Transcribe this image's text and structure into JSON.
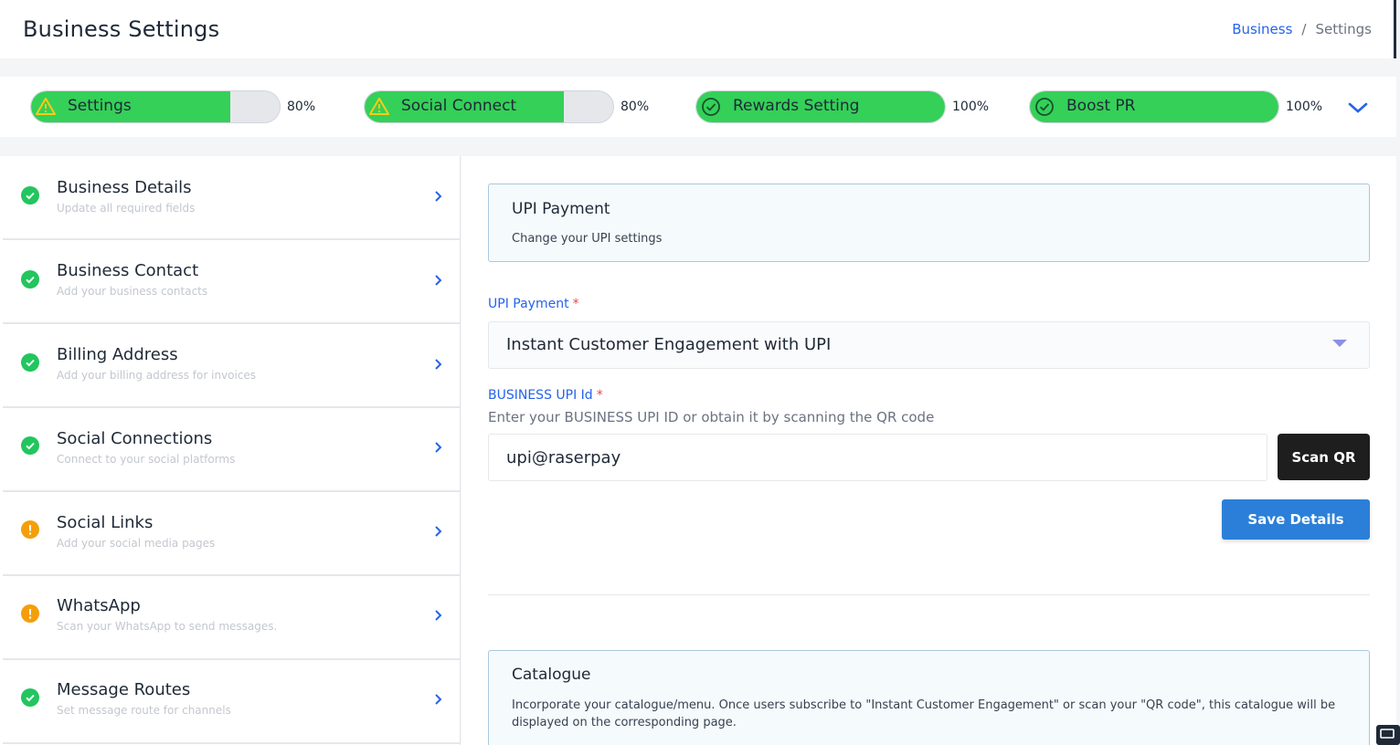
{
  "header": {
    "title": "Business Settings",
    "breadcrumb": {
      "link": "Business",
      "separator": "/",
      "current": "Settings"
    }
  },
  "progress": [
    {
      "label": "Settings",
      "percent_text": "80%",
      "value": 80,
      "status": "warning"
    },
    {
      "label": "Social Connect",
      "percent_text": "80%",
      "value": 80,
      "status": "warning"
    },
    {
      "label": "Rewards Setting",
      "percent_text": "100%",
      "value": 100,
      "status": "complete"
    },
    {
      "label": "Boost PR",
      "percent_text": "100%",
      "value": 100,
      "status": "complete"
    }
  ],
  "sidebar": {
    "items": [
      {
        "title": "Business Details",
        "subtitle": "Update all required fields",
        "status": "complete"
      },
      {
        "title": "Business Contact",
        "subtitle": "Add your business contacts",
        "status": "complete"
      },
      {
        "title": "Billing Address",
        "subtitle": "Add your billing address for invoices",
        "status": "complete"
      },
      {
        "title": "Social Connections",
        "subtitle": "Connect to your social platforms",
        "status": "complete"
      },
      {
        "title": "Social Links",
        "subtitle": "Add your social media pages",
        "status": "warning"
      },
      {
        "title": "WhatsApp",
        "subtitle": "Scan your WhatsApp to send messages.",
        "status": "warning"
      },
      {
        "title": "Message Routes",
        "subtitle": "Set message route for channels",
        "status": "complete"
      }
    ]
  },
  "upi_card": {
    "title": "UPI Payment",
    "description": "Change your UPI settings"
  },
  "form": {
    "upi_payment_label": "UPI Payment",
    "required_mark": "*",
    "upi_payment_value": "Instant Customer Engagement with UPI",
    "upi_id_label": "BUSINESS UPI Id",
    "upi_id_hint": "Enter your BUSINESS UPI ID or obtain it by scanning the QR code",
    "upi_id_value": "upi@raserpay",
    "scan_label": "Scan QR",
    "save_label": "Save Details"
  },
  "catalogue_card": {
    "title": "Catalogue",
    "description": "Incorporate your catalogue/menu. Once users subscribe to \"Instant Customer Engagement\" or scan your \"QR code\", this catalogue will be displayed on the corresponding page."
  },
  "colors": {
    "accent": "#2b7fd8",
    "progress_fill": "#34d058",
    "status_ok": "#22c55e",
    "status_warn": "#f59e0b",
    "scan_button": "#1e1e1e"
  }
}
